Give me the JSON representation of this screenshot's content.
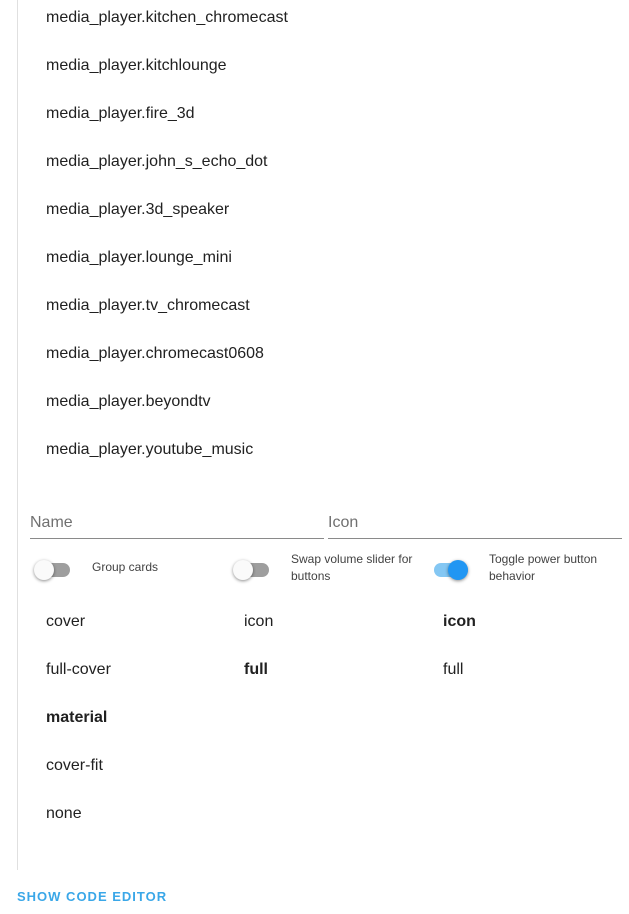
{
  "entity_list": [
    "media_player.kitchen_chromecast",
    "media_player.kitchlounge",
    "media_player.fire_3d",
    "media_player.john_s_echo_dot",
    "media_player.3d_speaker",
    "media_player.lounge_mini",
    "media_player.tv_chromecast",
    "media_player.chromecast0608",
    "media_player.beyondtv",
    "media_player.youtube_music"
  ],
  "fields": {
    "name": {
      "placeholder": "Name",
      "value": ""
    },
    "icon": {
      "placeholder": "Icon",
      "value": ""
    }
  },
  "switches": [
    {
      "label": "Group cards",
      "on": false
    },
    {
      "label": "Swap volume slider for buttons",
      "on": false
    },
    {
      "label": "Toggle power button behavior",
      "on": true
    }
  ],
  "options": {
    "artwork": [
      {
        "label": "cover",
        "selected": false
      },
      {
        "label": "full-cover",
        "selected": false
      },
      {
        "label": "material",
        "selected": true
      },
      {
        "label": "cover-fit",
        "selected": false
      },
      {
        "label": "none",
        "selected": false
      }
    ],
    "info": [
      {
        "label": "icon",
        "selected": false
      },
      {
        "label": "full",
        "selected": true
      }
    ],
    "power": [
      {
        "label": "icon",
        "selected": true
      },
      {
        "label": "full",
        "selected": false
      }
    ]
  },
  "footer": {
    "code_editor_label": "SHOW CODE EDITOR"
  },
  "colors": {
    "accent": "#2196f3",
    "link": "#3aa7e8",
    "divider": "#e0e0e0"
  }
}
